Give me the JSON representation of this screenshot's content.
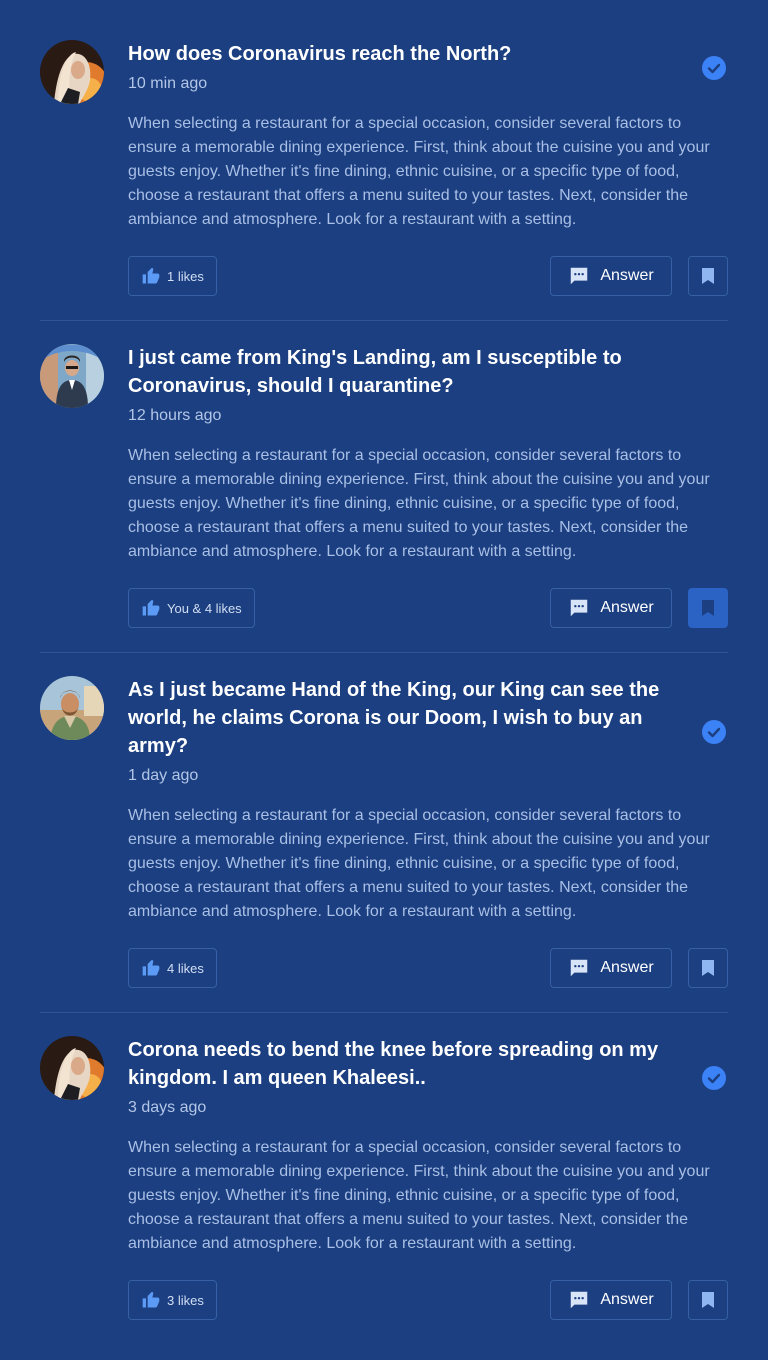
{
  "posts": [
    {
      "title": "How does Coronavirus reach the North?",
      "time": "10 min ago",
      "body": "When selecting a restaurant for a special occasion, consider several factors to ensure a memorable dining experience. First, think about the cuisine you and your guests enjoy. Whether it's fine dining, ethnic cuisine, or a specific type of food, choose a restaurant that offers a menu suited to your tastes. Next, consider the ambiance and atmosphere. Look for a restaurant with a setting.",
      "likes": "1 likes",
      "answer": "Answer",
      "verified": true,
      "bookmarked": false
    },
    {
      "title": "I just came from King's Landing, am I susceptible to Coronavirus, should I quarantine?",
      "time": "12 hours ago",
      "body": "When selecting a restaurant for a special occasion, consider several factors to ensure a memorable dining experience. First, think about the cuisine you and your guests enjoy. Whether it's fine dining, ethnic cuisine, or a specific type of food, choose a restaurant that offers a menu suited to your tastes. Next, consider the ambiance and atmosphere. Look for a restaurant with a setting.",
      "likes": "You & 4 likes",
      "answer": "Answer",
      "verified": false,
      "bookmarked": true
    },
    {
      "title": "As I just became Hand of the King, our King can see the world, he claims Corona is our Doom, I wish to buy an army?",
      "time": "1 day ago",
      "body": "When selecting a restaurant for a special occasion, consider several factors to ensure a memorable dining experience. First, think about the cuisine you and your guests enjoy. Whether it's fine dining, ethnic cuisine, or a specific type of food, choose a restaurant that offers a menu suited to your tastes. Next, consider the ambiance and atmosphere. Look for a restaurant with a setting.",
      "likes": "4 likes",
      "answer": "Answer",
      "verified": true,
      "bookmarked": false
    },
    {
      "title": "Corona needs to bend the knee before spreading on my kingdom. I am queen Khaleesi..",
      "time": "3 days ago",
      "body": "When selecting a restaurant for a special occasion, consider several factors to ensure a memorable dining experience. First, think about the cuisine you and your guests enjoy. Whether it's fine dining, ethnic cuisine, or a specific type of food, choose a restaurant that offers a menu suited to your tastes. Next, consider the ambiance and atmosphere. Look for a restaurant with a setting.",
      "likes": "3 likes",
      "answer": "Answer",
      "verified": true,
      "bookmarked": false
    }
  ],
  "colors": {
    "background": "#1b3f80",
    "accent": "#3b82f6",
    "border": "#3760a6"
  }
}
